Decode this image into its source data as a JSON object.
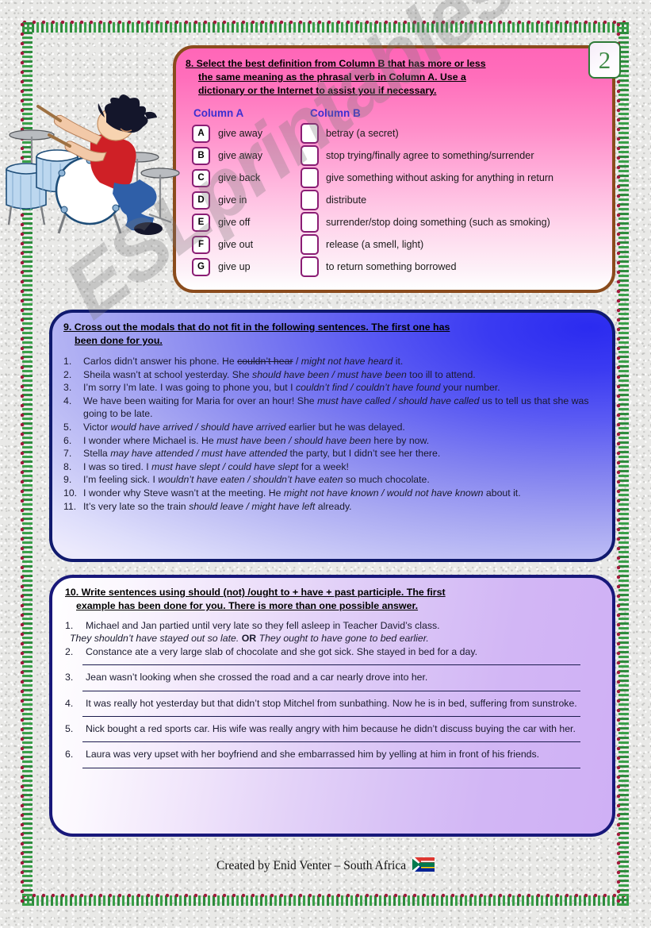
{
  "page": {
    "number": "2",
    "watermark": "ESLprintables.com"
  },
  "clipart": {
    "drummer": "drummer-cartoon"
  },
  "section8": {
    "heading_line1": "8. Select the best definition from Column B that has more or less",
    "heading_line2": "the same meaning as the phrasal verb in Column A. Use a",
    "heading_line3": "dictionary or the Internet to assist you if necessary.",
    "column_a_label": "Column A",
    "column_b_label": "Column B",
    "rows": [
      {
        "letter": "A",
        "verb": "give away",
        "definition": "betray (a secret)"
      },
      {
        "letter": "B",
        "verb": "give away",
        "definition": "stop trying/finally agree to something/surrender"
      },
      {
        "letter": "C",
        "verb": "give back",
        "definition": "give something without asking for anything in return"
      },
      {
        "letter": "D",
        "verb": "give in",
        "definition": "distribute"
      },
      {
        "letter": "E",
        "verb": "give off",
        "definition": "surrender/stop doing something (such as smoking)"
      },
      {
        "letter": "F",
        "verb": "give out",
        "definition": "release (a smell, light)"
      },
      {
        "letter": "G",
        "verb": "give up",
        "definition": "to return something borrowed"
      }
    ]
  },
  "section9": {
    "heading_line1": "9. Cross out the modals that do not fit in the following sentences. The first one has",
    "heading_line2": "been done for you.",
    "items": [
      {
        "num": "1.",
        "pre": "Carlos didn’t answer his phone. He ",
        "strike": "couldn’t hear",
        "mid": " / ",
        "em": "might not have heard",
        "post": " it."
      },
      {
        "num": "2.",
        "pre": "Sheila wasn’t at school yesterday. She ",
        "strike": "",
        "mid": "",
        "em": "should have been / must have been",
        "post": " too ill to attend."
      },
      {
        "num": "3.",
        "pre": "I’m sorry I’m late. I was going to phone you, but I ",
        "strike": "",
        "mid": "",
        "em": "couldn’t find / couldn’t have found",
        "post": " your number."
      },
      {
        "num": "4.",
        "pre": "We have been waiting for Maria for over an hour! She ",
        "strike": "",
        "mid": "",
        "em": "must have called / should have called",
        "post": " us to tell us that she was going to be late."
      },
      {
        "num": "5.",
        "pre": "Victor ",
        "strike": "",
        "mid": "",
        "em": "would have arrived / should have arrived",
        "post": " earlier but he was delayed."
      },
      {
        "num": "6.",
        "pre": "I wonder where Michael is. He ",
        "strike": "",
        "mid": "",
        "em": "must have been / should have been",
        "post": " here by now."
      },
      {
        "num": "7.",
        "pre": "Stella ",
        "strike": "",
        "mid": "",
        "em": "may have attended / must have attended",
        "post": " the party, but I didn’t see her there."
      },
      {
        "num": "8.",
        "pre": "I was so tired. I ",
        "strike": "",
        "mid": "",
        "em": "must have slept / could have slept",
        "post": " for a week!"
      },
      {
        "num": "9.",
        "pre": "I’m feeling sick. I ",
        "strike": "",
        "mid": "",
        "em": "wouldn’t have eaten / shouldn’t have eaten",
        "post": " so much chocolate."
      },
      {
        "num": "10.",
        "pre": "I wonder why Steve wasn’t at the meeting. He ",
        "strike": "",
        "mid": "",
        "em": "might not have known / would not have known",
        "post": " about it."
      },
      {
        "num": "11.",
        "pre": "It’s very late so the train ",
        "strike": "",
        "mid": "",
        "em": "should leave / might have left",
        "post": " already."
      }
    ]
  },
  "section10": {
    "heading_line1": "10. Write sentences using should (not) /ought to + have + past participle. The first",
    "heading_line2": "example has been done for you. There is more than one possible answer.",
    "items": [
      {
        "num": "1.",
        "text": "Michael and Jan partied until very late so they fell asleep in Teacher David’s class.",
        "answer_prefix": "They shouldn’t have stayed out so late.",
        "answer_or": "OR",
        "answer_suffix": "They ought to have gone to bed earlier.",
        "has_blank_line": false
      },
      {
        "num": "2.",
        "text": "Constance ate a very large slab of chocolate and she got sick. She stayed in bed for a day.",
        "answer_prefix": "",
        "answer_or": "",
        "answer_suffix": "",
        "has_blank_line": true
      },
      {
        "num": "3.",
        "text": "Jean wasn’t looking when she crossed the road and a car nearly drove into her.",
        "answer_prefix": "",
        "answer_or": "",
        "answer_suffix": "",
        "has_blank_line": true
      },
      {
        "num": "4.",
        "text": "It was really hot yesterday but that didn’t stop Mitchel from sunbathing. Now he is in bed, suffering from sunstroke.",
        "answer_prefix": "",
        "answer_or": "",
        "answer_suffix": "",
        "has_blank_line": true
      },
      {
        "num": "5.",
        "text": "Nick bought a red sports car. His wife was really angry with him because he didn’t discuss buying the car with her.",
        "answer_prefix": "",
        "answer_or": "",
        "answer_suffix": "",
        "has_blank_line": true
      },
      {
        "num": "6.",
        "text": "Laura was very upset with her boyfriend and she embarrassed him by yelling at him in front of his friends.",
        "answer_prefix": "",
        "answer_or": "",
        "answer_suffix": "",
        "has_blank_line": true
      }
    ]
  },
  "footer": {
    "credit": "Created by Enid Venter – South Africa",
    "flag": "south-africa-flag"
  },
  "colors": {
    "pink_top": "#ff66b8",
    "pink_border": "#8a4b1c",
    "blue_accent": "#2b2bf0",
    "blue_border": "#101a6e",
    "purple_border": "#18187a",
    "column_label": "#3b2fd0",
    "letterbox_border": "#8a1d74",
    "badge_green": "#3f8a46"
  }
}
